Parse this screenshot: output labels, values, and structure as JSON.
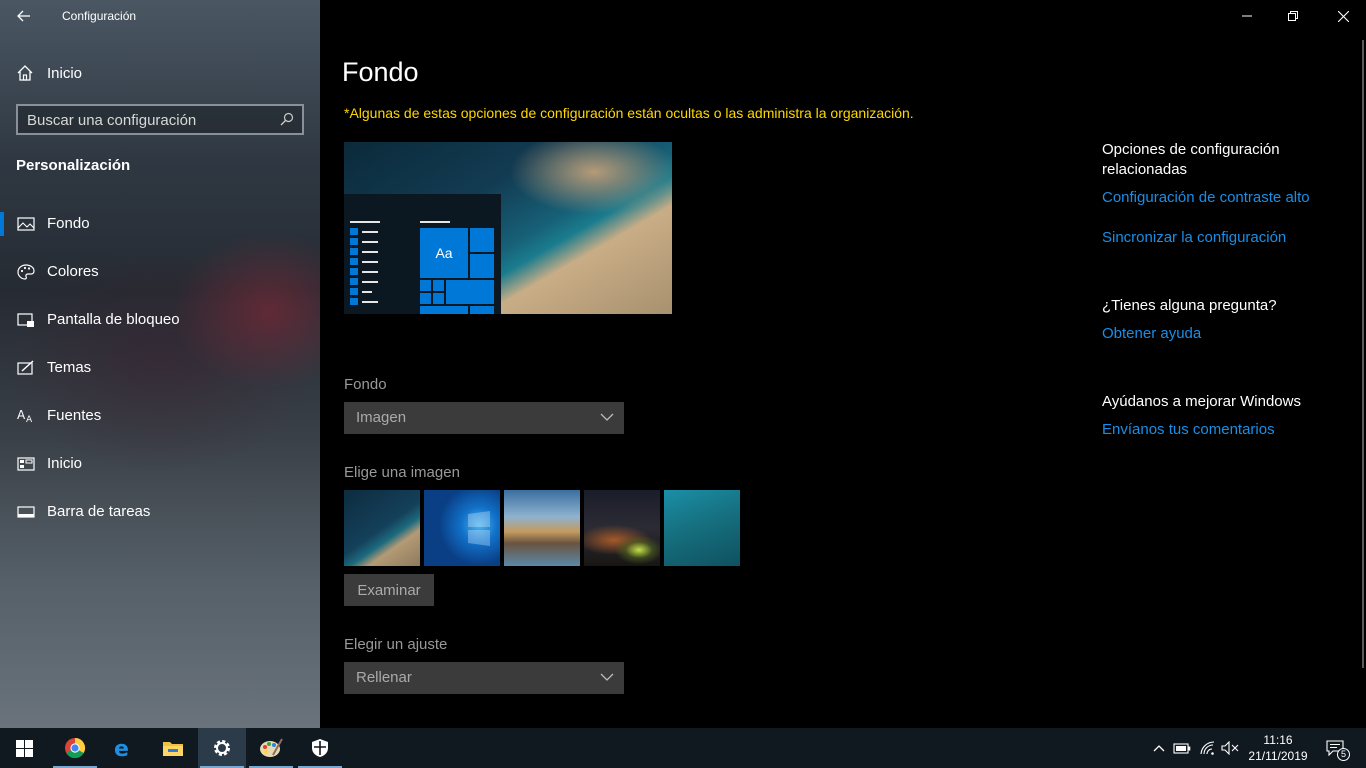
{
  "window": {
    "title": "Configuración"
  },
  "sidebar": {
    "home_label": "Inicio",
    "search_placeholder": "Buscar una configuración",
    "section_title": "Personalización",
    "items": [
      {
        "label": "Fondo",
        "icon": "picture-icon",
        "active": true
      },
      {
        "label": "Colores",
        "icon": "palette-icon",
        "active": false
      },
      {
        "label": "Pantalla de bloqueo",
        "icon": "lock-screen-icon",
        "active": false
      },
      {
        "label": "Temas",
        "icon": "themes-icon",
        "active": false
      },
      {
        "label": "Fuentes",
        "icon": "fonts-icon",
        "active": false
      },
      {
        "label": "Inicio",
        "icon": "start-icon",
        "active": false
      },
      {
        "label": "Barra de tareas",
        "icon": "taskbar-icon",
        "active": false
      }
    ]
  },
  "main": {
    "title": "Fondo",
    "org_note": "*Algunas de estas opciones de configuración están ocultas o las administra la organización.",
    "preview_tile_label": "Aa",
    "background_label": "Fondo",
    "background_value": "Imagen",
    "choose_image_label": "Elige una imagen",
    "browse_button": "Examinar",
    "fit_label": "Elegir un ajuste",
    "fit_value": "Rellenar"
  },
  "related": {
    "heading": "Opciones de configuración relacionadas",
    "high_contrast_link": "Configuración de contraste alto",
    "sync_link": "Sincronizar la configuración",
    "question_heading": "¿Tienes alguna pregunta?",
    "help_link": "Obtener ayuda",
    "improve_heading": "Ayúdanos a mejorar Windows",
    "feedback_link": "Envíanos tus comentarios"
  },
  "taskbar": {
    "apps": [
      "start-icon",
      "chrome-icon",
      "edge-icon",
      "file-explorer-icon",
      "settings-icon",
      "paint-icon",
      "security-icon"
    ],
    "time": "11:16",
    "date": "21/11/2019",
    "notification_count": "5"
  },
  "colors": {
    "accent": "#0078d7",
    "link": "#1a8ee6",
    "warning_text": "#ffd800"
  }
}
